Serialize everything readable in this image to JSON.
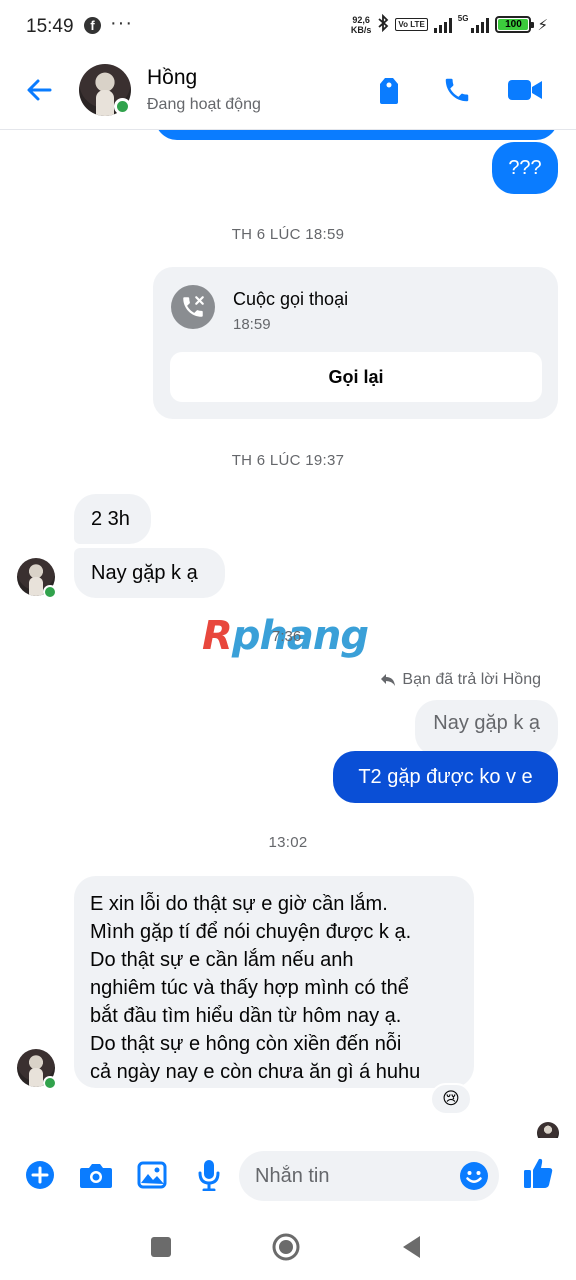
{
  "status_bar": {
    "time": "15:49",
    "net_speed_value": "92,6",
    "net_speed_unit": "KB/s",
    "volte": "Vo LTE",
    "network": "5G",
    "battery": "100"
  },
  "header": {
    "contact_name": "Hồng",
    "contact_status": "Đang hoạt động"
  },
  "messages": {
    "out_question": "???",
    "ts_1": "TH 6 LÚC 18:59",
    "call_title": "Cuộc gọi thoại",
    "call_time": "18:59",
    "callback_label": "Gọi lại",
    "ts_2": "TH 6 LÚC 19:37",
    "in_1": "2 3h",
    "in_2": "Nay gặp k ạ",
    "watermark_r": "R",
    "watermark_rest": "phang",
    "ts_3": "7:36",
    "reply_note": "Bạn đã trả lời Hồng",
    "quoted_text": "Nay gặp k ạ",
    "out_reply": "T2 gặp được ko v e",
    "ts_4": "13:02",
    "long_msg_lines": [
      "E xin lỗi do thật sự e giờ cần lắm.",
      "Mình gặp tí để nói chuyện được k ạ.",
      "Do thật sự e cần lắm nếu anh",
      "nghiêm túc và thấy hợp mình có thể",
      "bắt đầu tìm hiểu dần từ hôm nay ạ.",
      "Do thật sự e hông còn  xiền  đến nỗi",
      "cả ngày nay e còn chưa ăn gì á huhu"
    ],
    "reaction": "😢"
  },
  "composer": {
    "placeholder": "Nhắn tin"
  },
  "colors": {
    "accent": "#0a7cff",
    "online": "#31a24c",
    "bubble_in": "#f0f2f5",
    "out_dark": "#0a4fd6"
  }
}
